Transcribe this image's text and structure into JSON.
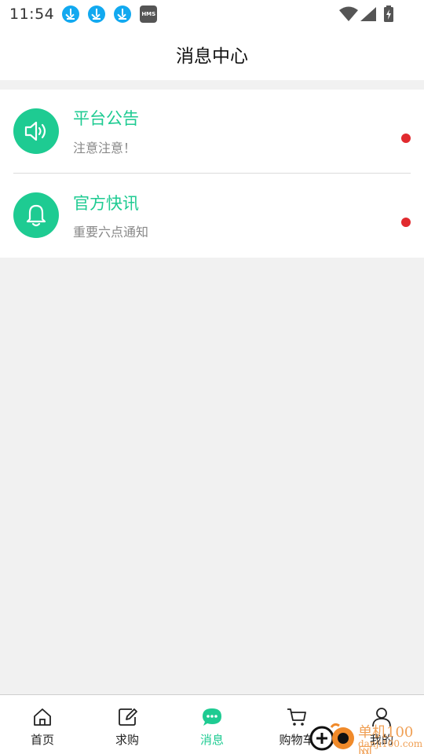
{
  "status_bar": {
    "time": "11:54",
    "badge": "HMS"
  },
  "header": {
    "title": "消息中心"
  },
  "messages": [
    {
      "icon": "speaker-icon",
      "title": "平台公告",
      "subtitle": "注意注意！",
      "unread": true
    },
    {
      "icon": "bell-icon",
      "title": "官方快讯",
      "subtitle": "重要六点通知",
      "unread": true
    }
  ],
  "tabs": [
    {
      "icon": "home-icon",
      "label": "首页",
      "active": false
    },
    {
      "icon": "edit-icon",
      "label": "求购",
      "active": false
    },
    {
      "icon": "chat-icon",
      "label": "消息",
      "active": true
    },
    {
      "icon": "cart-icon",
      "label": "购物车",
      "active": false
    },
    {
      "icon": "user-icon",
      "label": "我的",
      "active": false
    }
  ],
  "watermark": {
    "main": "单机100网",
    "sub": "danji100.com"
  },
  "colors": {
    "accent": "#1ecb92",
    "unread_dot": "#e12a2e",
    "download_badge": "#12a9f0",
    "background": "#f1f1f1"
  }
}
